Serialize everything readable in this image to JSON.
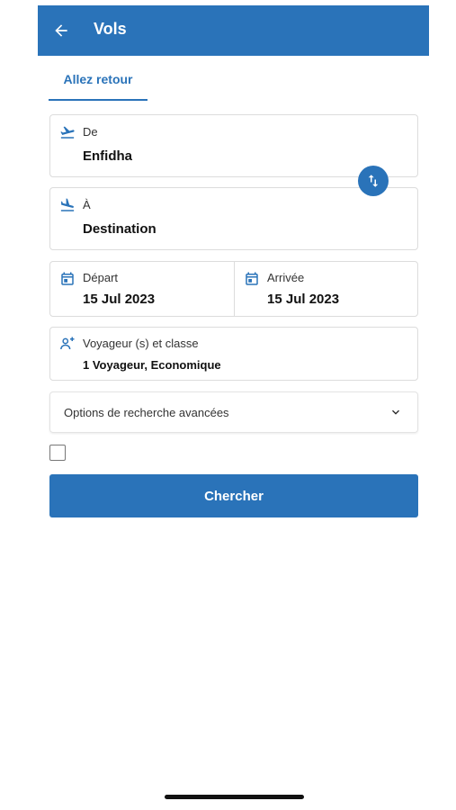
{
  "header": {
    "title": "Vols",
    "back_icon": "arrow-left-icon"
  },
  "tabs": [
    {
      "label": "Allez retour",
      "active": true
    }
  ],
  "form": {
    "from": {
      "label": "De",
      "value": "Enfidha",
      "icon": "plane-takeoff-icon"
    },
    "to": {
      "label": "À",
      "value": "Destination",
      "icon": "plane-landing-icon"
    },
    "swap_icon": "swap-vertical-icon",
    "departure": {
      "label": "Départ",
      "value": "15 Jul 2023",
      "icon": "calendar-icon"
    },
    "arrival": {
      "label": "Arrivée",
      "value": "15 Jul 2023",
      "icon": "calendar-icon"
    },
    "travelers": {
      "label": "Voyageur (s) et classe",
      "value": "1 Voyageur, Economique",
      "icon": "person-add-icon"
    },
    "advanced_options": {
      "label": "Options de recherche avancées",
      "icon": "chevron-down-icon"
    },
    "checkbox": {
      "checked": false
    },
    "search_button": {
      "label": "Chercher"
    }
  },
  "colors": {
    "primary": "#2a73b9",
    "border": "#dcdcdc",
    "text": "#111111"
  }
}
